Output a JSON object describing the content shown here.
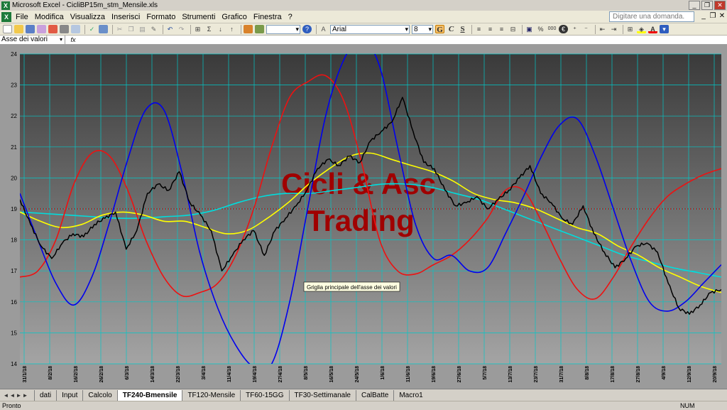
{
  "window": {
    "title": "Microsoft Excel - CicliBP15m_stm_Mensile.xls",
    "buttons": [
      "_",
      "❐",
      "✕"
    ]
  },
  "menubar": {
    "items": [
      "File",
      "Modifica",
      "Visualizza",
      "Inserisci",
      "Formato",
      "Strumenti",
      "Grafico",
      "Finestra",
      "?"
    ],
    "help_placeholder": "Digitare una domanda.",
    "mdi_buttons": [
      "_",
      "❐",
      "✕"
    ]
  },
  "toolbar": {
    "font_name": "Arial",
    "font_size": "8",
    "bold": "G",
    "italic": "C",
    "underline": "S",
    "percent": "%",
    "thousands": "000",
    "euro": "€"
  },
  "formula": {
    "namebox": "Asse dei valori",
    "fx": "fx"
  },
  "chart": {
    "watermark_line1": "Cicli & Asc",
    "watermark_line2": "Trading",
    "tooltip": "Griglia principale dell'asse dei valori",
    "colors": {
      "price": "#000000",
      "oscillator": "#3333cc",
      "blue_cycle": "#0000ee",
      "red_cycle": "#ee1111",
      "yellow_avg": "#ffff00",
      "cyan_avg": "#00dddd",
      "level_line": "#cc0000",
      "grid": "#00c8c8",
      "watermark": "#a00000"
    }
  },
  "chart_data": {
    "type": "line",
    "ylim": [
      14,
      24
    ],
    "y_ticks": [
      "24",
      "23",
      "22",
      "21",
      "20",
      "19",
      "18",
      "17",
      "16",
      "15",
      "14"
    ],
    "x_ticks": [
      "31/1/18",
      "8/2/18",
      "16/2/18",
      "26/2/18",
      "6/3/18",
      "14/3/18",
      "22/3/18",
      "3/4/18",
      "11/4/18",
      "19/4/18",
      "27/4/18",
      "8/5/18",
      "16/5/18",
      "24/5/18",
      "1/6/18",
      "11/6/18",
      "19/6/18",
      "27/6/18",
      "5/7/18",
      "13/7/18",
      "23/7/18",
      "31/7/18",
      "8/8/18",
      "17/8/18",
      "27/8/18",
      "4/9/18",
      "12/9/18",
      "20/9/18"
    ],
    "reference_level": 19,
    "series": [
      {
        "name": "",
        "key": "price",
        "values": [
          19.3,
          18.5,
          17.8,
          17.4,
          17.9,
          18.2,
          18.1,
          18.5,
          18.7,
          18.9,
          17.7,
          18.3,
          19.5,
          19.8,
          19.6,
          20.2,
          19.2,
          18.8,
          18.3,
          17.0,
          17.5,
          18.0,
          18.3,
          17.5,
          18.3,
          18.7,
          19.1,
          19.6,
          20.3,
          20.6,
          20.4,
          20.7,
          20.5,
          21.2,
          21.5,
          21.8,
          22.6,
          21.5,
          20.5,
          20.3,
          19.6,
          19.1,
          19.2,
          19.4,
          19.0,
          19.3,
          19.6,
          20.0,
          20.4,
          19.5,
          19.2,
          18.7,
          18.5,
          19.1,
          18.2,
          17.6,
          17.1,
          17.4,
          17.8,
          17.9,
          17.6,
          16.6,
          15.8,
          15.6,
          15.9,
          16.3,
          16.4
        ]
      },
      {
        "name": "",
        "key": "blue_cycle",
        "values": [
          19.5,
          18.0,
          16.6,
          15.9,
          16.8,
          18.6,
          20.6,
          22.2,
          22.2,
          20.2,
          17.6,
          15.8,
          14.6,
          13.9,
          14.0,
          16.0,
          19.0,
          22.0,
          23.8,
          24.5,
          23.6,
          21.0,
          18.5,
          17.4,
          17.5,
          17.0,
          17.1,
          18.2,
          19.4,
          20.7,
          21.7,
          21.9,
          20.7,
          19.0,
          17.3,
          16.0,
          15.7,
          16.0,
          16.6,
          17.2
        ]
      },
      {
        "name": "",
        "key": "red_cycle",
        "values": [
          16.8,
          17.0,
          18.0,
          19.8,
          20.8,
          20.7,
          19.6,
          18.0,
          16.8,
          16.2,
          16.3,
          16.6,
          17.5,
          19.0,
          21.0,
          22.6,
          23.1,
          23.3,
          22.5,
          20.5,
          18.0,
          17.0,
          16.9,
          17.2,
          17.5,
          18.0,
          18.7,
          19.6,
          19.6,
          18.6,
          17.4,
          16.4,
          16.1,
          16.8,
          17.8,
          18.7,
          19.4,
          19.8,
          20.1,
          20.3
        ]
      },
      {
        "name": "",
        "key": "yellow_avg",
        "values": [
          18.9,
          18.6,
          18.4,
          18.5,
          18.8,
          18.9,
          18.8,
          18.6,
          18.6,
          18.4,
          18.2,
          18.3,
          18.7,
          19.2,
          19.8,
          20.3,
          20.7,
          20.8,
          20.6,
          20.4,
          20.2,
          19.9,
          19.5,
          19.3,
          19.2,
          19.0,
          18.7,
          18.4,
          18.2,
          17.8,
          17.5,
          17.1,
          16.8,
          16.5,
          16.3
        ]
      },
      {
        "name": "",
        "key": "cyan_avg",
        "values": [
          18.9,
          18.85,
          18.8,
          18.75,
          18.7,
          18.7,
          18.75,
          18.8,
          18.95,
          19.2,
          19.4,
          19.5,
          19.5,
          19.6,
          19.7,
          19.8,
          19.8,
          19.7,
          19.5,
          19.3,
          19.0,
          18.7,
          18.4,
          18.1,
          17.8,
          17.5,
          17.3,
          17.1,
          16.95,
          16.8
        ]
      }
    ]
  }
}
